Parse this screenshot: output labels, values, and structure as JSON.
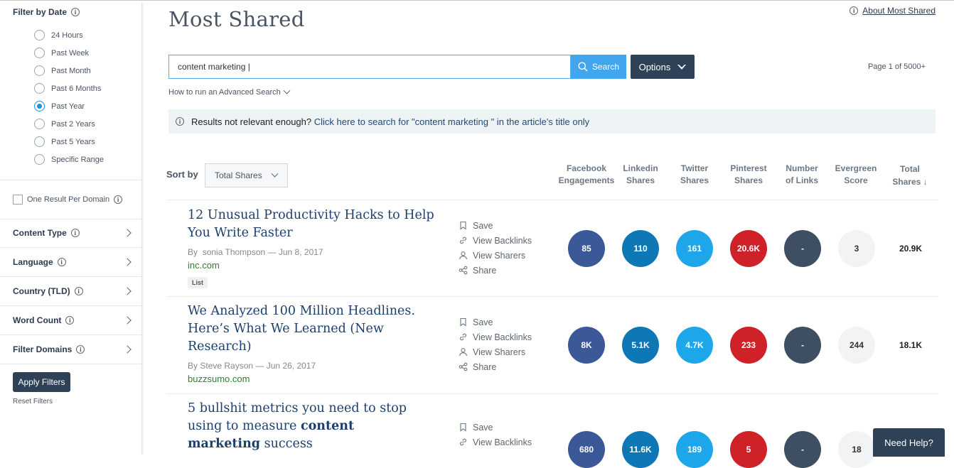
{
  "sidebar": {
    "filter_by_date": "Filter by Date",
    "date_options": [
      "24 Hours",
      "Past Week",
      "Past Month",
      "Past 6 Months",
      "Past Year",
      "Past 2 Years",
      "Past 5 Years",
      "Specific Range"
    ],
    "selected_date": "Past Year",
    "one_result_per_domain": "One Result Per Domain",
    "content_type": "Content Type",
    "language": "Language",
    "country": "Country (TLD)",
    "word_count": "Word Count",
    "filter_domains": "Filter Domains",
    "apply_filters": "Apply Filters",
    "reset_filters": "Reset Filters"
  },
  "header": {
    "title": "Most Shared",
    "about_link": "About Most Shared"
  },
  "search": {
    "value": "content marketing |",
    "button_label": "Search",
    "options_label": "Options",
    "page_count": "Page 1 of 5000+",
    "advanced_link": "How to run an Advanced Search"
  },
  "notice": {
    "prefix": "Results not relevant enough?",
    "link": "Click here to search for \"content marketing \" in the article's title only"
  },
  "sort": {
    "label": "Sort by",
    "value": "Total Shares"
  },
  "columns": {
    "facebook": [
      "Facebook",
      "Engagements"
    ],
    "linkedin": [
      "Linkedin",
      "Shares"
    ],
    "twitter": [
      "Twitter",
      "Shares"
    ],
    "pinterest": [
      "Pinterest",
      "Shares"
    ],
    "links": [
      "Number",
      "of Links"
    ],
    "evergreen": [
      "Evergreen",
      "Score"
    ],
    "total": [
      "Total",
      "Shares ↓"
    ]
  },
  "actions": [
    "Save",
    "View Backlinks",
    "View Sharers",
    "Share"
  ],
  "articles": [
    {
      "title": "12 Unusual Productivity Hacks to Help You Write Faster",
      "author_prefix": "By",
      "author": "sonia Thompson",
      "date": "— Jun 8, 2017",
      "domain": "inc.com",
      "tag": "List",
      "facebook": "85",
      "linkedin": "110",
      "twitter": "161",
      "pinterest": "20.6K",
      "links": "-",
      "evergreen": "3",
      "total": "20.9K"
    },
    {
      "title": "We Analyzed 100 Million Headlines. Here’s What We Learned (New Research)",
      "author_prefix": "By",
      "author": "Steve Rayson",
      "date": "— Jun 26, 2017",
      "domain": "buzzsumo.com",
      "facebook": "8K",
      "linkedin": "5.1K",
      "twitter": "4.7K",
      "pinterest": "233",
      "links": "-",
      "evergreen": "244",
      "total": "18.1K"
    },
    {
      "title_pre": "5 bullshit metrics you need to stop using to measure",
      "title_bold": "content marketing",
      "title_post": "success",
      "facebook": "680",
      "linkedin": "11.6K",
      "twitter": "189",
      "pinterest": "5",
      "links": "-",
      "evergreen": "18"
    }
  ],
  "help": "Need Help?"
}
